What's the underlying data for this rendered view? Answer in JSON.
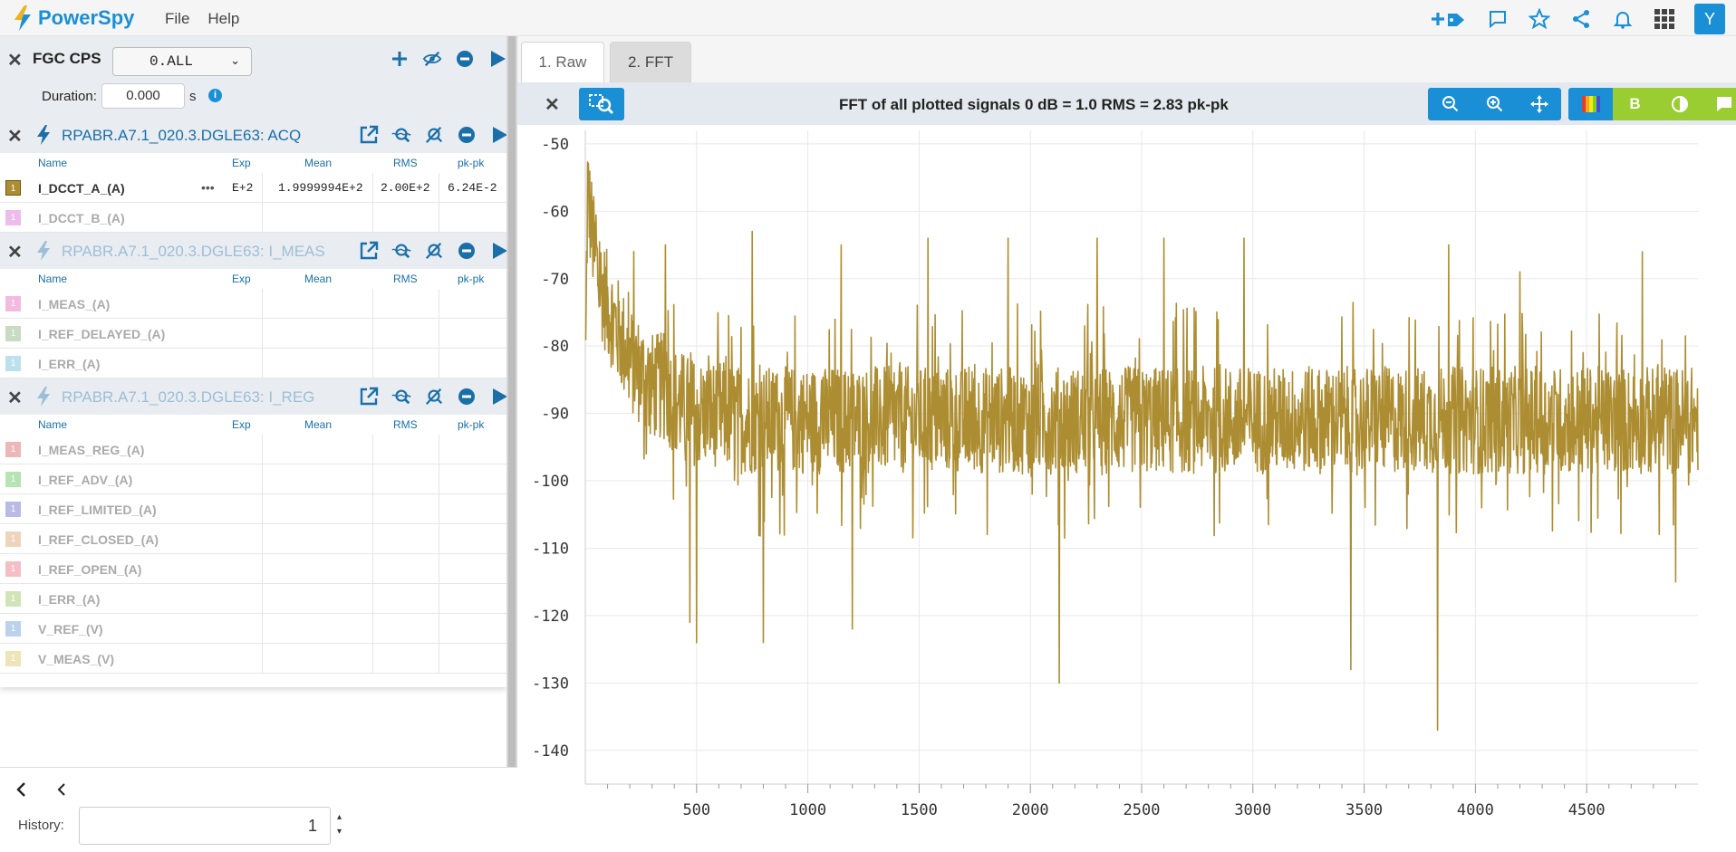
{
  "app": {
    "name": "PowerSpy",
    "menu": [
      "File",
      "Help"
    ],
    "avatar_letter": "Y"
  },
  "topbar_icons": [
    "add-tag-icon",
    "comment-icon",
    "star-icon",
    "share-icon",
    "bell-icon",
    "apps-grid-icon"
  ],
  "cps": {
    "title": "FGC CPS",
    "selector": "0.ALL",
    "duration_label": "Duration:",
    "duration_value": "0.000",
    "duration_unit": "s"
  },
  "columns": {
    "name": "Name",
    "exp": "Exp",
    "mean": "Mean",
    "rms": "RMS",
    "pkpk": "pk-pk"
  },
  "groups": [
    {
      "title": "RPABR.A7.1_020.3.DGLE63: ACQ",
      "active": true,
      "signals": [
        {
          "name": "I_DCCT_A_(A)",
          "color": "#ad8d32",
          "exp": "E+2",
          "mean": "1.9999994E+2",
          "rms": "2.00E+2",
          "pkpk": "6.24E-2",
          "active": true,
          "more": "•••"
        },
        {
          "name": "I_DCCT_B_(A)",
          "color": "#e8a6e3",
          "active": false
        }
      ]
    },
    {
      "title": "RPABR.A7.1_020.3.DGLE63: I_MEAS",
      "active": false,
      "signals": [
        {
          "name": "I_MEAS_(A)",
          "color": "#f0a3d6"
        },
        {
          "name": "I_REF_DELAYED_(A)",
          "color": "#b8d1ae"
        },
        {
          "name": "I_ERR_(A)",
          "color": "#a8d6e8"
        }
      ]
    },
    {
      "title": "RPABR.A7.1_020.3.DGLE63: I_REG",
      "active": false,
      "signals": [
        {
          "name": "I_MEAS_REG_(A)",
          "color": "#e8a0a0"
        },
        {
          "name": "I_REF_ADV_(A)",
          "color": "#9edc9a"
        },
        {
          "name": "I_REF_LIMITED_(A)",
          "color": "#a3a3e0"
        },
        {
          "name": "I_REF_CLOSED_(A)",
          "color": "#eac6a6"
        },
        {
          "name": "I_REF_OPEN_(A)",
          "color": "#f2a8b4"
        },
        {
          "name": "I_ERR_(A)",
          "color": "#c4dca0"
        },
        {
          "name": "V_REF_(V)",
          "color": "#a6c2e6"
        },
        {
          "name": "V_MEAS_(V)",
          "color": "#e8dca0"
        }
      ]
    }
  ],
  "swatch_label": "1",
  "history": {
    "label": "History:",
    "value": "1"
  },
  "tabs": [
    {
      "label": "1. Raw",
      "active": false
    },
    {
      "label": "2. FFT",
      "active": true
    }
  ],
  "plot_title": "FFT of all plotted signals 0 dB = 1.0 RMS = 2.83 pk-pk",
  "chart_data": {
    "type": "line",
    "title": "FFT of all plotted signals 0 dB = 1.0 RMS = 2.83 pk-pk",
    "xlabel": "",
    "ylabel": "",
    "xlim": [
      0,
      5000
    ],
    "ylim": [
      -145,
      -48
    ],
    "xticks": [
      500,
      1000,
      1500,
      2000,
      2500,
      3000,
      3500,
      4000,
      4500
    ],
    "yticks": [
      -50,
      -60,
      -70,
      -80,
      -90,
      -100,
      -110,
      -120,
      -130,
      -140
    ],
    "grid": true,
    "series": [
      {
        "color": "#ad8d32",
        "x": [
          0,
          10,
          20,
          40,
          60,
          80,
          100,
          150,
          200,
          250,
          300,
          350,
          400,
          450,
          500,
          550,
          600,
          700,
          800,
          900,
          1000,
          1100,
          1200,
          1300,
          1400,
          1500,
          1600,
          1700,
          1800,
          1900,
          2000,
          2100,
          2200,
          2300,
          2400,
          2500,
          2600,
          2700,
          2800,
          2900,
          3000,
          3100,
          3200,
          3300,
          3400,
          3500,
          3600,
          3700,
          3800,
          3900,
          4000,
          4100,
          4200,
          4300,
          4400,
          4500,
          4600,
          4700,
          4800,
          4900,
          5000
        ],
        "y": [
          -88,
          -56,
          -60,
          -66,
          -70,
          -72,
          -74,
          -78,
          -82,
          -84,
          -86,
          -86,
          -88,
          -89,
          -90,
          -90,
          -90,
          -91,
          -91,
          -91,
          -91,
          -91,
          -91,
          -91,
          -91,
          -91,
          -91,
          -91,
          -91,
          -91,
          -91,
          -91,
          -91,
          -91,
          -91,
          -91,
          -91,
          -91,
          -91,
          -91,
          -91,
          -91,
          -91,
          -91,
          -91,
          -91,
          -91,
          -91,
          -91,
          -91,
          -91,
          -91,
          -91,
          -91,
          -91,
          -91,
          -91,
          -91,
          -91,
          -91,
          -91
        ],
        "band_half_width_db": 8,
        "spikes": [
          {
            "x": 470,
            "y": -121
          },
          {
            "x": 500,
            "y": -124
          },
          {
            "x": 360,
            "y": -65
          },
          {
            "x": 750,
            "y": -63
          },
          {
            "x": 800,
            "y": -124
          },
          {
            "x": 1150,
            "y": -65
          },
          {
            "x": 1200,
            "y": -122
          },
          {
            "x": 1540,
            "y": -64
          },
          {
            "x": 1900,
            "y": -64
          },
          {
            "x": 2130,
            "y": -130
          },
          {
            "x": 2300,
            "y": -64
          },
          {
            "x": 2600,
            "y": -64
          },
          {
            "x": 2960,
            "y": -64
          },
          {
            "x": 3440,
            "y": -128
          },
          {
            "x": 3830,
            "y": -137
          },
          {
            "x": 3880,
            "y": -65
          },
          {
            "x": 4200,
            "y": -69
          },
          {
            "x": 4750,
            "y": -66
          },
          {
            "x": 4900,
            "y": -115
          }
        ]
      }
    ]
  }
}
